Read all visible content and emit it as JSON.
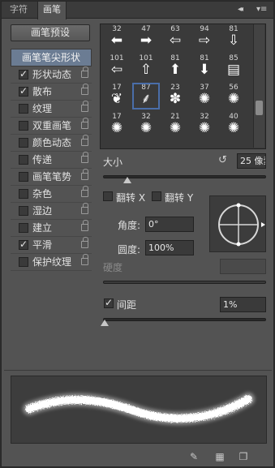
{
  "tabs": [
    {
      "label": "字符"
    },
    {
      "label": "画笔"
    }
  ],
  "panel_controls": {
    "collapse": "◂◂",
    "menu": "▾≡"
  },
  "preset_button": "画笔预设",
  "left_list": {
    "header": "画笔笔尖形状",
    "items": [
      {
        "label": "形状动态",
        "checked": true
      },
      {
        "label": "散布",
        "checked": true
      },
      {
        "label": "纹理",
        "checked": false
      },
      {
        "label": "双重画笔",
        "checked": false
      },
      {
        "label": "颜色动态",
        "checked": false
      },
      {
        "label": "传递",
        "checked": false
      },
      {
        "label": "画笔笔势",
        "checked": false
      },
      {
        "label": "杂色",
        "checked": false
      },
      {
        "label": "湿边",
        "checked": false
      },
      {
        "label": "建立",
        "checked": false
      },
      {
        "label": "平滑",
        "checked": true
      },
      {
        "label": "保护纹理",
        "checked": false
      }
    ]
  },
  "brush_grid": [
    {
      "num": "32",
      "icon": "arrow-left"
    },
    {
      "num": "47",
      "icon": "arrow-right"
    },
    {
      "num": "63",
      "icon": "arrow-left-outline"
    },
    {
      "num": "94",
      "icon": "arrow-right-outline"
    },
    {
      "num": "81",
      "icon": "arrow-down-outline"
    },
    {
      "num": "101",
      "icon": "arrow-left-round"
    },
    {
      "num": "101",
      "icon": "arrow-up-outline"
    },
    {
      "num": "81",
      "icon": "arrow-up"
    },
    {
      "num": "81",
      "icon": "arrow-down"
    },
    {
      "num": "85",
      "icon": "text-brush"
    },
    {
      "num": "17",
      "icon": "leaf-brush"
    },
    {
      "num": "87",
      "icon": "feather-brush"
    },
    {
      "num": "23",
      "icon": "grass-brush"
    },
    {
      "num": "37",
      "icon": "splatter-brush"
    },
    {
      "num": "56",
      "icon": "splatter-brush"
    },
    {
      "num": "17",
      "icon": "splatter-brush"
    },
    {
      "num": "32",
      "icon": "splatter-brush"
    },
    {
      "num": "21",
      "icon": "splatter-brush"
    },
    {
      "num": "32",
      "icon": "splatter-brush"
    },
    {
      "num": "40",
      "icon": "splatter-brush"
    }
  ],
  "selected_brush_index": 11,
  "size": {
    "label": "大小",
    "value": "25 像素",
    "slider_fraction": 0.05
  },
  "flip_x": {
    "label": "翻转 X",
    "checked": false
  },
  "flip_y": {
    "label": "翻转 Y",
    "checked": false
  },
  "angle": {
    "label": "角度:",
    "value": "0°"
  },
  "roundness": {
    "label": "圆度:",
    "value": "100%"
  },
  "hardness": {
    "label": "硬度",
    "value": ""
  },
  "spacing": {
    "label": "间距",
    "checked": true,
    "value": "1%",
    "slider_fraction": 0.0
  },
  "colors": {
    "panel_bg": "#535353",
    "selected_header": "#6b7c93",
    "selection_outline": "#4a6ea9"
  }
}
